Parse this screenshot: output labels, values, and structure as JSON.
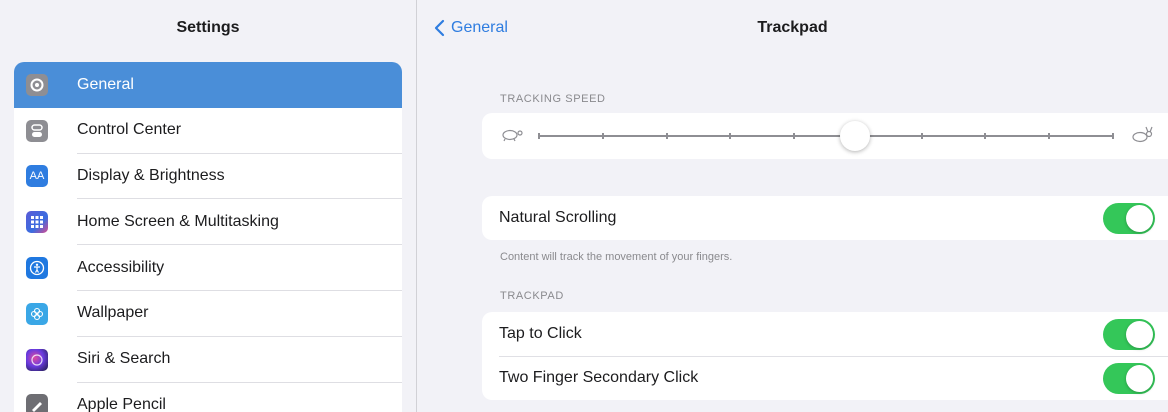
{
  "sidebar": {
    "title": "Settings",
    "items": [
      {
        "label": "General",
        "icon": "gear-icon",
        "selected": true
      },
      {
        "label": "Control Center",
        "icon": "switches-icon",
        "selected": false
      },
      {
        "label": "Display & Brightness",
        "icon": "text-size-icon",
        "icon_glyph": "AA",
        "selected": false
      },
      {
        "label": "Home Screen & Multitasking",
        "icon": "app-grid-icon",
        "selected": false
      },
      {
        "label": "Accessibility",
        "icon": "accessibility-icon",
        "selected": false
      },
      {
        "label": "Wallpaper",
        "icon": "flower-icon",
        "selected": false
      },
      {
        "label": "Siri & Search",
        "icon": "siri-icon",
        "selected": false
      },
      {
        "label": "Apple Pencil",
        "icon": "pencil-icon",
        "selected": false
      }
    ]
  },
  "nav": {
    "back_label": "General",
    "title": "Trackpad"
  },
  "tracking_speed": {
    "header": "TRACKING SPEED",
    "ticks": 10,
    "value_fraction": 0.55,
    "min_icon": "turtle-icon",
    "max_icon": "rabbit-icon"
  },
  "natural_scrolling": {
    "label": "Natural Scrolling",
    "on": true,
    "footer": "Content will track the movement of your fingers."
  },
  "trackpad": {
    "header": "TRACKPAD",
    "rows": [
      {
        "label": "Tap to Click",
        "on": true
      },
      {
        "label": "Two Finger Secondary Click",
        "on": true
      }
    ]
  },
  "colors": {
    "accent": "#2f7de0",
    "selected_row": "#4a8ed8",
    "toggle_on": "#34c759",
    "background": "#f2f2f7"
  }
}
